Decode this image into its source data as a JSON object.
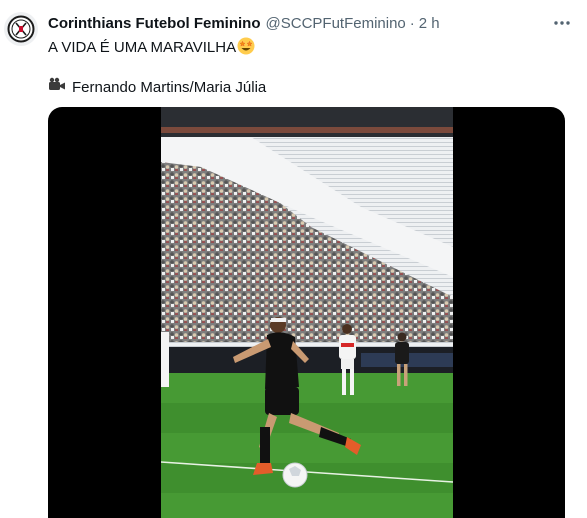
{
  "tweet": {
    "author_name": "Corinthians Futebol Feminino",
    "handle": "@SCCPFutFeminino",
    "separator": "·",
    "timestamp": "2 h",
    "text_line1": "A VIDA É UMA MARAVILHA",
    "text_line1_emoji": "star-struck-emoji",
    "credit_icon": "movie-camera-icon",
    "credit": "Fernando Martins/Maria Júlia",
    "avatar_icon": "corinthians-crest-icon",
    "more_icon": "more-dots-icon"
  },
  "colors": {
    "text": "#0f1419",
    "secondary": "#536471",
    "pitch": "#3f8f2e",
    "seats": "#e9ecef",
    "media_background": "#000000"
  }
}
